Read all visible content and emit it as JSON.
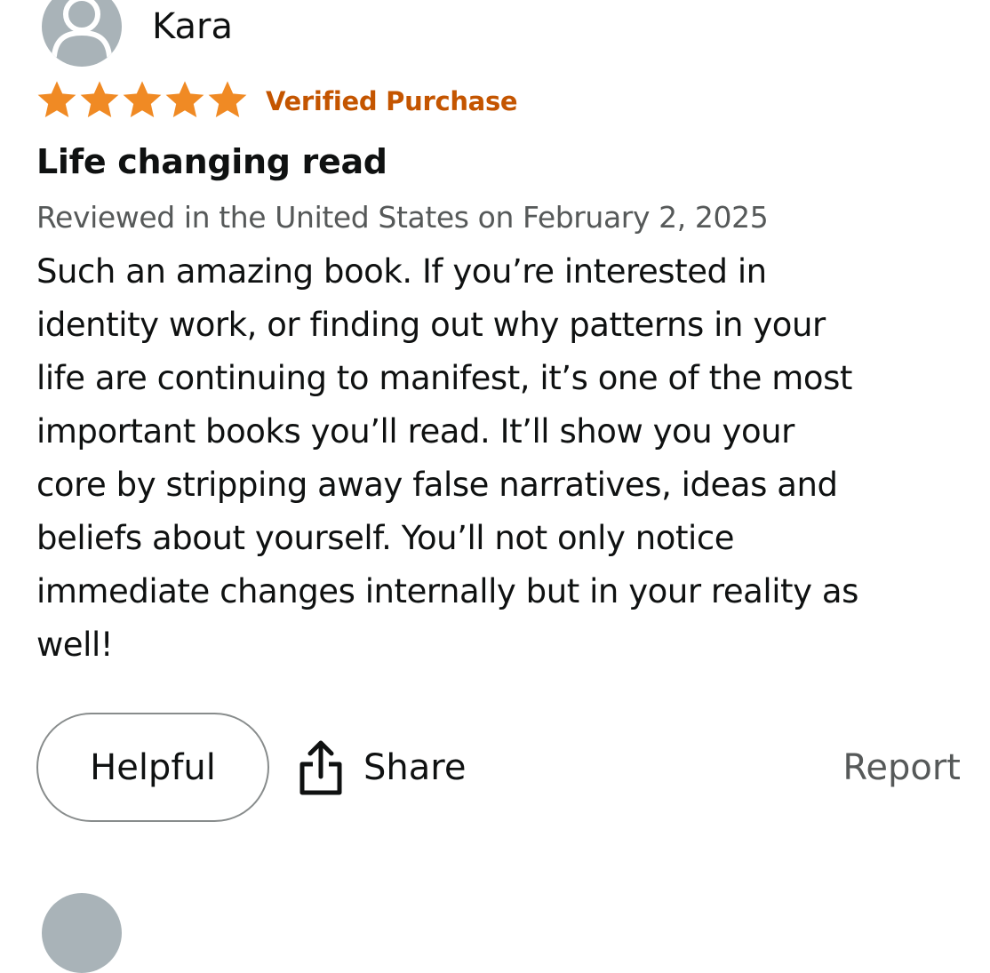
{
  "review": {
    "reviewer_name": "Kara",
    "rating": 5,
    "rating_max": 5,
    "star_color": "#f08a24",
    "verified_label": "Verified Purchase",
    "title": "Life changing read",
    "date_line": "Reviewed in the United States on February 2, 2025",
    "body_lines": [
      "Such an amazing book. If you’re interested in",
      "identity work, or finding out why patterns in your",
      "life are continuing to manifest, it’s one of the most",
      "important books you’ll read. It’ll show you your",
      "core by stripping away false narratives, ideas and",
      "beliefs about yourself. You’ll not only notice",
      "immediate changes internally but in your reality as",
      "well!"
    ]
  },
  "actions": {
    "helpful_label": "Helpful",
    "share_label": "Share",
    "report_label": "Report"
  },
  "icons": {
    "avatar": "person-icon",
    "share": "share-icon",
    "star": "star-icon"
  },
  "colors": {
    "verified": "#c45500",
    "secondary_text": "#565959",
    "avatar_bg": "#a9b3b8"
  }
}
